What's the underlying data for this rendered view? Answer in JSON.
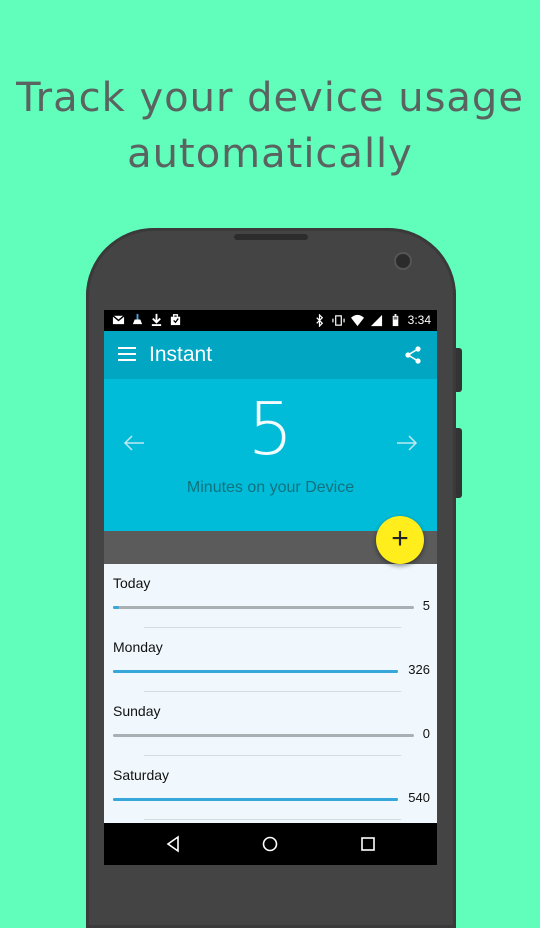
{
  "headline": {
    "line1": "Track your device usage",
    "line2": "automatically"
  },
  "status_bar": {
    "time": "3:34",
    "left_icons": [
      "gmail-icon",
      "cleaner-icon",
      "download-icon",
      "store-bag-icon"
    ],
    "right_icons": [
      "bluetooth-icon",
      "vibrate-icon",
      "wifi-icon",
      "signal-icon",
      "battery-icon"
    ]
  },
  "app_bar": {
    "title": "Instant",
    "menu_icon": "hamburger-menu-icon",
    "share_icon": "share-icon"
  },
  "summary": {
    "value": "5",
    "caption": "Minutes on your Device",
    "prev_icon": "arrow-left-icon",
    "next_icon": "arrow-right-icon"
  },
  "fab": {
    "label": "+"
  },
  "days": [
    {
      "name": "Today",
      "value": "5",
      "fraction": 0.02
    },
    {
      "name": "Monday",
      "value": "326",
      "fraction": 1.0
    },
    {
      "name": "Sunday",
      "value": "0",
      "fraction": 0.0
    },
    {
      "name": "Saturday",
      "value": "540",
      "fraction": 1.0
    }
  ],
  "nav_bar": {
    "icons": [
      "back-icon",
      "home-icon",
      "recents-icon"
    ]
  },
  "colors": {
    "background": "#60fdbb",
    "app_bar": "#00a6c2",
    "hero": "#00bcd8",
    "fab": "#ffed1c",
    "progress": "#36a7d8"
  }
}
